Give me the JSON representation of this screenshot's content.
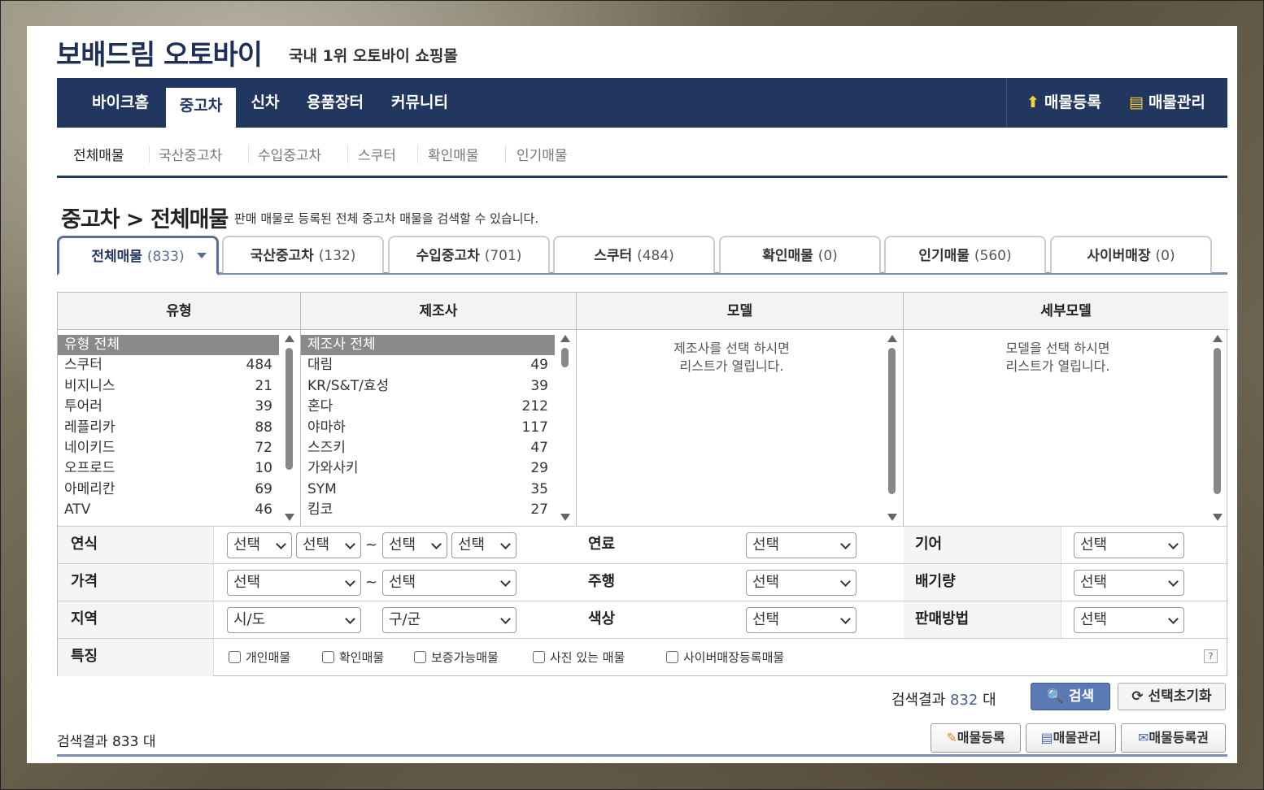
{
  "site": {
    "logo": "보배드림 오토바이",
    "tagline": "국내 1위 오토바이 쇼핑몰"
  },
  "gnb": {
    "items": [
      "바이크홈",
      "중고차",
      "신차",
      "용품장터",
      "커뮤니티"
    ],
    "active": "중고차",
    "register": "매물등록",
    "manage": "매물관리"
  },
  "sub_nav": {
    "items": [
      "전체매물",
      "국산중고차",
      "수입중고차",
      "스쿠터",
      "확인매물",
      "인기매물"
    ],
    "active": "전체매물"
  },
  "page": {
    "title": "중고차 > 전체매물",
    "desc": "판매 매물로 등록된 전체 중고차 매물을 검색할 수 있습니다."
  },
  "tabs": [
    {
      "label": "전체매물",
      "count": "(833)"
    },
    {
      "label": "국산중고차",
      "count": "(132)"
    },
    {
      "label": "수입중고차",
      "count": "(701)"
    },
    {
      "label": "스쿠터",
      "count": "(484)"
    },
    {
      "label": "확인매물",
      "count": "(0)"
    },
    {
      "label": "인기매물",
      "count": "(560)"
    },
    {
      "label": "사이버매장",
      "count": "(0)"
    }
  ],
  "filters": {
    "headers": {
      "type": "유형",
      "maker": "제조사",
      "model": "모델",
      "submodel": "세부모델"
    },
    "types": [
      {
        "name": "유형 전체",
        "count": ""
      },
      {
        "name": "스쿠터",
        "count": "484"
      },
      {
        "name": "비지니스",
        "count": "21"
      },
      {
        "name": "투어러",
        "count": "39"
      },
      {
        "name": "레플리카",
        "count": "88"
      },
      {
        "name": "네이키드",
        "count": "72"
      },
      {
        "name": "오프로드",
        "count": "10"
      },
      {
        "name": "아메리칸",
        "count": "69"
      },
      {
        "name": "ATV",
        "count": "46"
      }
    ],
    "makers": [
      {
        "name": "제조사 전체",
        "count": ""
      },
      {
        "name": "대림",
        "count": "49"
      },
      {
        "name": "KR/S&T/효성",
        "count": "39"
      },
      {
        "name": "혼다",
        "count": "212"
      },
      {
        "name": "야마하",
        "count": "117"
      },
      {
        "name": "스즈키",
        "count": "47"
      },
      {
        "name": "가와사키",
        "count": "29"
      },
      {
        "name": "SYM",
        "count": "35"
      },
      {
        "name": "킴코",
        "count": "27"
      }
    ],
    "model_msg": "제조사를 선택 하시면\n리스트가 열립니다.",
    "submodel_msg": "모델을 선택 하시면\n리스트가 열립니다."
  },
  "fields": {
    "year": "연식",
    "price": "가격",
    "region": "지역",
    "feature": "특징",
    "fuel": "연료",
    "mileage": "주행",
    "color": "색상",
    "gear": "기어",
    "displacement": "배기량",
    "sale_method": "판매방법",
    "select": "선택",
    "sido": "시/도",
    "gugun": "구/군",
    "tilde": "~"
  },
  "features": [
    "개인매물",
    "확인매물",
    "보증가능매물",
    "사진 있는 매물",
    "사이버매장등록매물"
  ],
  "help": "?",
  "result": {
    "label": "검색결과",
    "count": "832",
    "unit": "대",
    "search_btn": "검색",
    "reset_btn": "선택초기화"
  },
  "footer": {
    "total": "검색결과 833 대",
    "btn_register": "매물등록",
    "btn_manage": "매물관리",
    "btn_ticket": "매물등록권"
  }
}
